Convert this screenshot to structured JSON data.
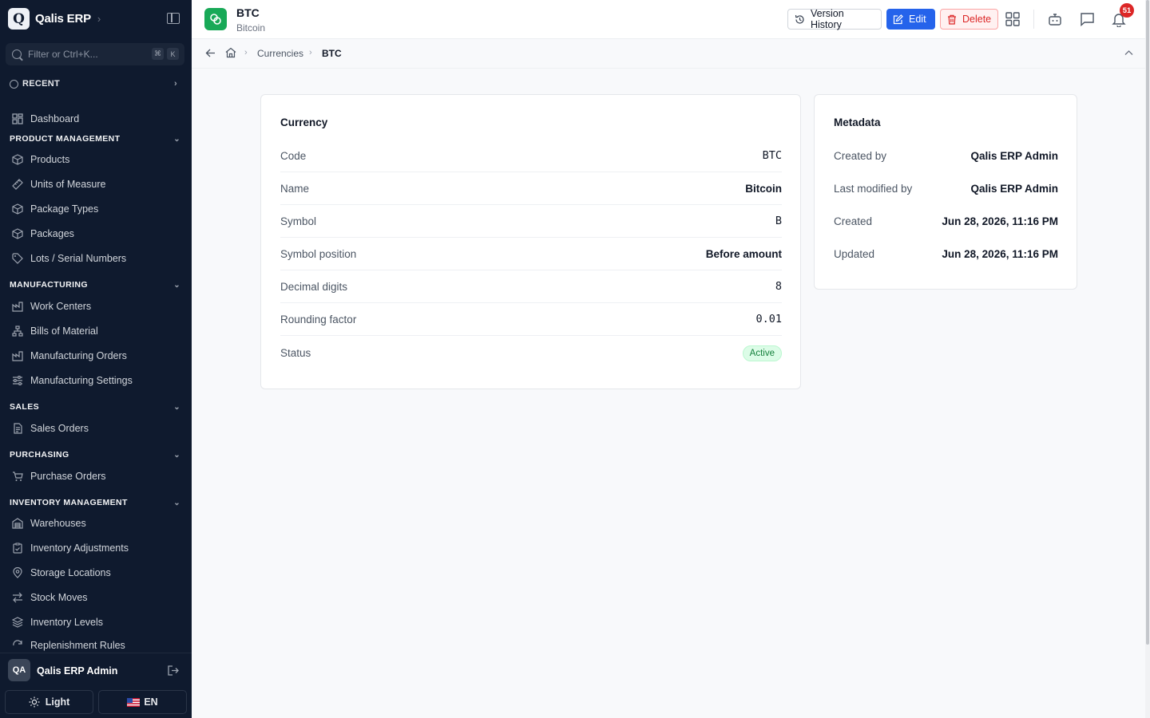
{
  "sidebar": {
    "brand_letter": "Q",
    "brand_name": "Qalis ERP",
    "filter_placeholder": "Filter or Ctrl+K...",
    "shortcut_keys": [
      "⌘",
      "K"
    ],
    "recent_label": "RECENT",
    "dashboard_label": "Dashboard",
    "sections": {
      "product_management": {
        "title": "PRODUCT MANAGEMENT",
        "items": [
          "Products",
          "Units of Measure",
          "Package Types",
          "Packages",
          "Lots / Serial Numbers"
        ]
      },
      "manufacturing": {
        "title": "MANUFACTURING",
        "items": [
          "Work Centers",
          "Bills of Material",
          "Manufacturing Orders",
          "Manufacturing Settings"
        ]
      },
      "sales": {
        "title": "SALES",
        "items": [
          "Sales Orders"
        ]
      },
      "purchasing": {
        "title": "PURCHASING",
        "items": [
          "Purchase Orders"
        ]
      },
      "inventory_management": {
        "title": "INVENTORY MANAGEMENT",
        "items": [
          "Warehouses",
          "Inventory Adjustments",
          "Storage Locations",
          "Stock Moves",
          "Inventory Levels",
          "Replenishment Rules"
        ]
      }
    },
    "user": {
      "initials": "QA",
      "name": "Qalis ERP Admin"
    },
    "theme_label": "Light",
    "language_label": "EN"
  },
  "header": {
    "title": "BTC",
    "subtitle": "Bitcoin",
    "version_history_label": "Version History",
    "edit_label": "Edit",
    "delete_label": "Delete",
    "notification_count": "51"
  },
  "breadcrumb": {
    "items": [
      "Currencies",
      "BTC"
    ]
  },
  "currency_card": {
    "title": "Currency",
    "rows": [
      {
        "label": "Code",
        "value": "BTC"
      },
      {
        "label": "Name",
        "value": "Bitcoin"
      },
      {
        "label": "Symbol",
        "value": "B"
      },
      {
        "label": "Symbol position",
        "value": "Before amount"
      },
      {
        "label": "Decimal digits",
        "value": "8"
      },
      {
        "label": "Rounding factor",
        "value": "0.01"
      },
      {
        "label": "Status",
        "value": "Active"
      }
    ]
  },
  "metadata_card": {
    "title": "Metadata",
    "rows": [
      {
        "label": "Created by",
        "value": "Qalis ERP Admin"
      },
      {
        "label": "Last modified by",
        "value": "Qalis ERP Admin"
      },
      {
        "label": "Created",
        "value": "Jun 28, 2026, 11:16 PM"
      },
      {
        "label": "Updated",
        "value": "Jun 28, 2026, 11:16 PM"
      }
    ]
  },
  "colors": {
    "sidebar_bg": "#0f1a2e",
    "accent_blue": "#2563eb",
    "danger_red": "#dc2626",
    "success_green": "#18a957"
  }
}
